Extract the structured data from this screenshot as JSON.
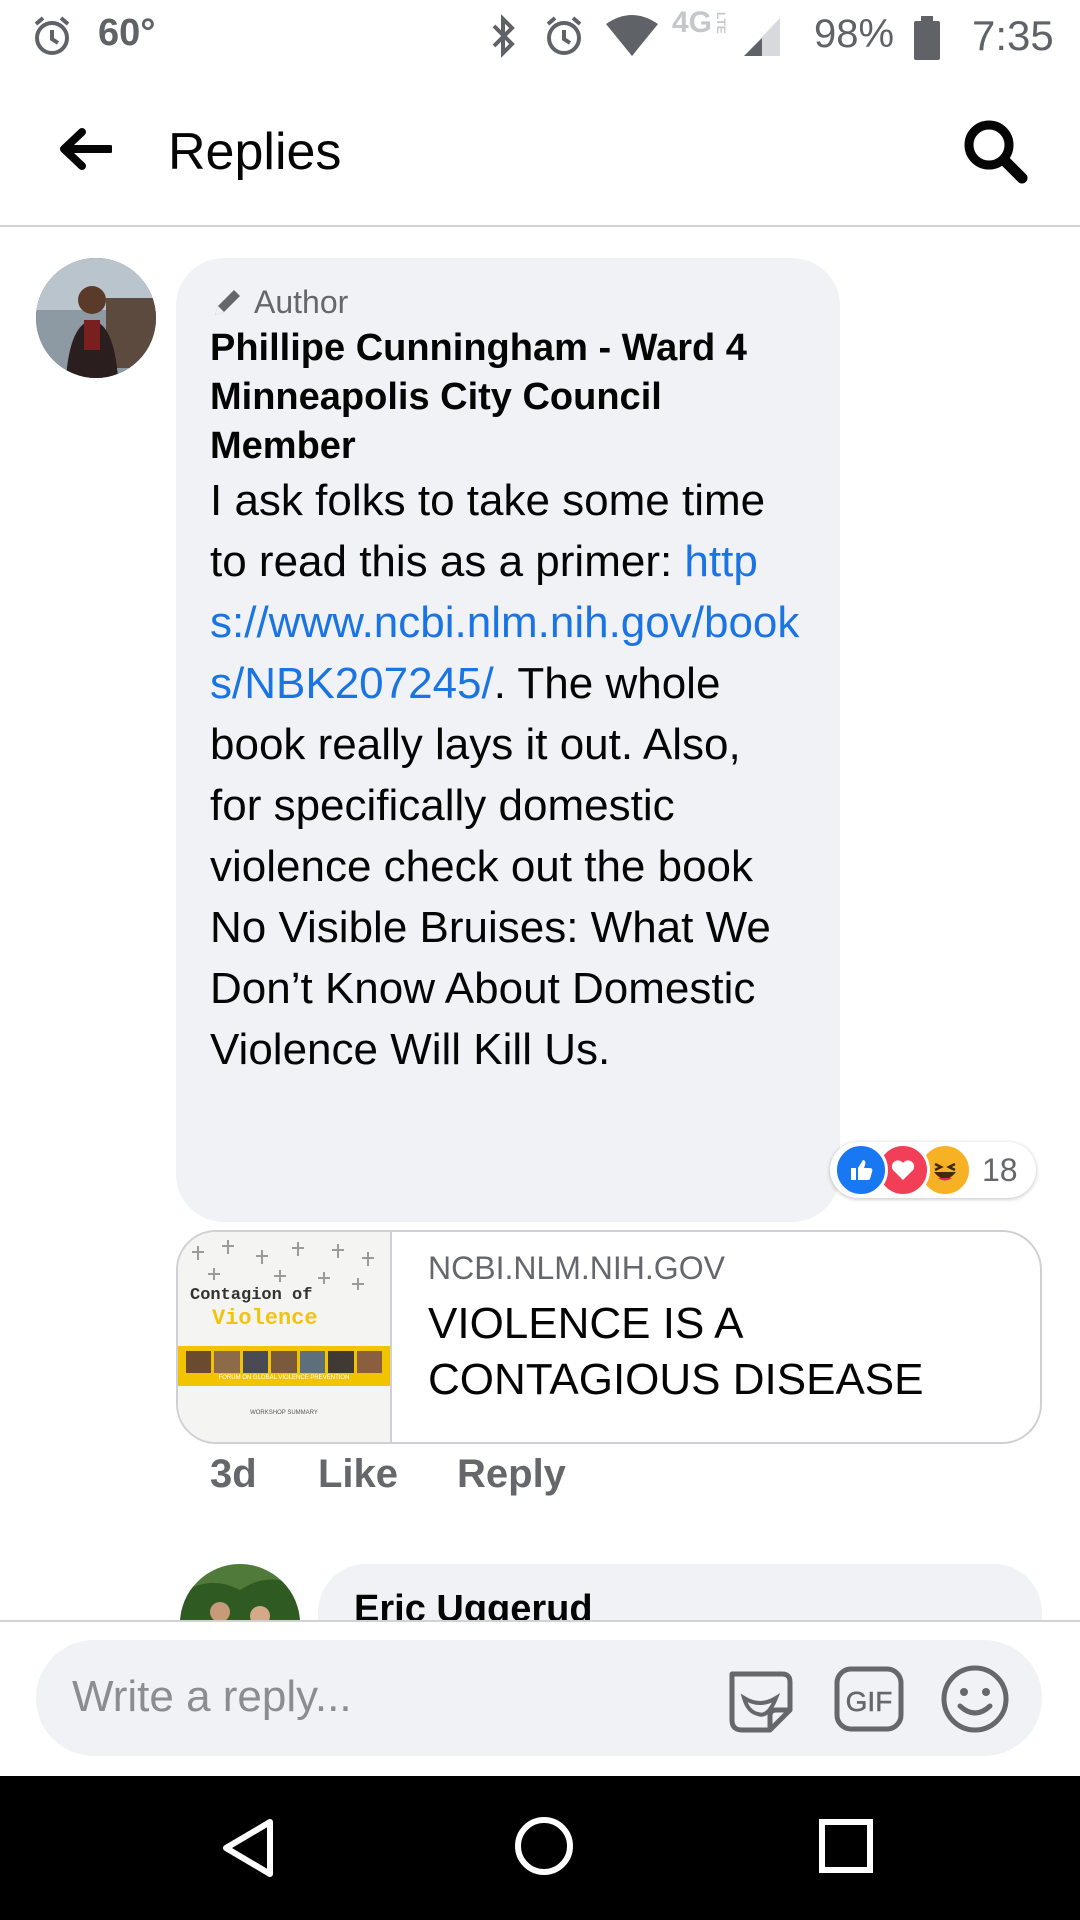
{
  "status_bar": {
    "temperature": "60°",
    "network": "4G",
    "network_sub": "LTE",
    "battery": "98%",
    "time": "7:35"
  },
  "header": {
    "title": "Replies"
  },
  "comment": {
    "badge": "Author",
    "author": "Phillipe Cunningham - Ward 4 Minneapolis City Council Member",
    "text_before_link": "I ask folks to take some time to read this as a primer: ",
    "link": "https://www.ncbi.nlm.nih.gov/books/NBK207245/",
    "text_after_link": ". The whole book really lays it out. Also, for specifically domestic violence check out the book No Visible Bruises: What We Don’t Know About Domestic Violence Will Kill Us.",
    "reaction_count": "18",
    "reactions": [
      "like-icon",
      "love-icon",
      "haha-icon"
    ],
    "time": "3d",
    "like_label": "Like",
    "reply_label": "Reply"
  },
  "link_preview": {
    "domain": "NCBI.NLM.NIH.GOV",
    "title": "VIOLENCE IS A CONTAGIOUS DISEASE",
    "thumb_line1": "Contagion of",
    "thumb_line2": "Violence",
    "thumb_footer": "FORUM ON GLOBAL VIOLENCE PREVENTION",
    "thumb_caption": "WORKSHOP SUMMARY"
  },
  "next_reply": {
    "author": "Eric Uggerud"
  },
  "composer": {
    "placeholder": "Write a reply..."
  },
  "colors": {
    "bubble": "#f0f2f5",
    "link": "#1b74e4",
    "like": "#1877f2",
    "love": "#f33e58",
    "haha": "#f7b125"
  }
}
